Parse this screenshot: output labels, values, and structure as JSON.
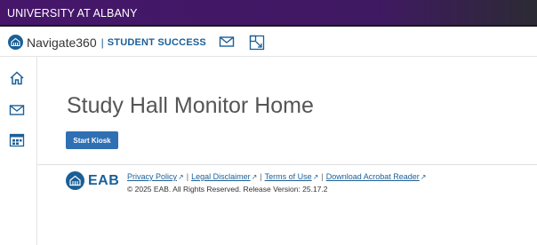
{
  "university_bar": {
    "label": "UNIVERSITY AT ALBANY"
  },
  "brand": {
    "name": "Navigate360",
    "separator": "|",
    "product": "STUDENT SUCCESS"
  },
  "topnav_icons": [
    "mail-icon",
    "appointment-icon"
  ],
  "sidebar_icons": [
    "home-icon",
    "mail-icon",
    "calendar-icon"
  ],
  "main": {
    "title": "Study Hall Monitor Home",
    "start_kiosk_label": "Start Kiosk"
  },
  "footer": {
    "logo_text": "EAB",
    "links": [
      "Privacy Policy",
      "Legal Disclaimer",
      "Terms of Use",
      "Download Acrobat Reader"
    ],
    "link_separator": "|",
    "copyright": "© 2025 EAB. All Rights Reserved. Release Version: 25.17.2"
  },
  "colors": {
    "university_bar": "#46166b",
    "brand_blue": "#1b5f97",
    "button_blue": "#2f6fb3"
  }
}
